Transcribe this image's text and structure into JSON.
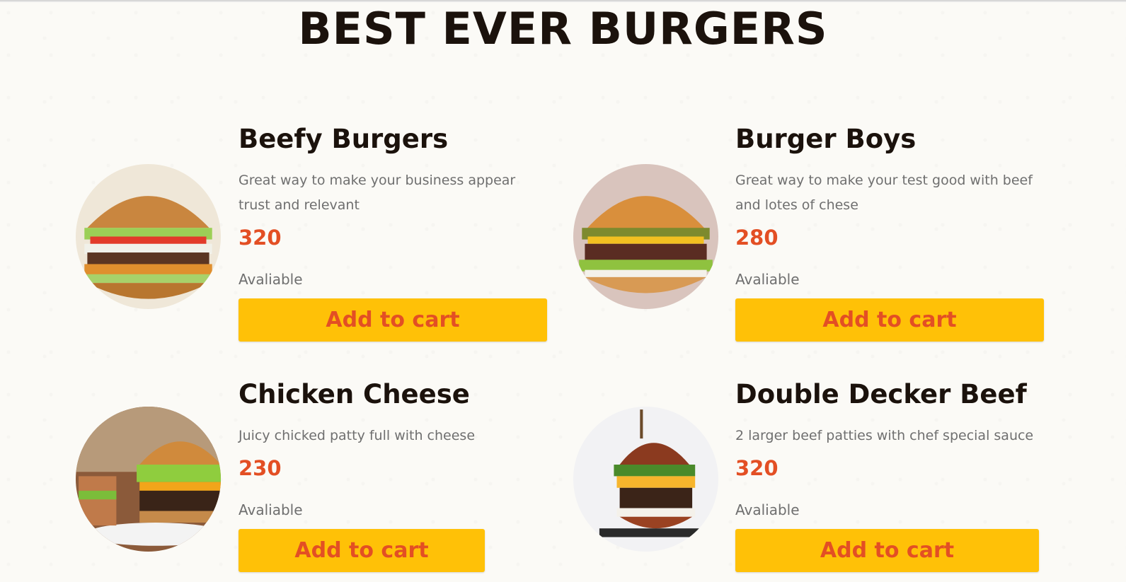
{
  "page": {
    "title": "BEST EVER BURGERS"
  },
  "menu": [
    {
      "name": "Beefy Burgers",
      "description": "Great way to make your business appear trust and relevant",
      "price": "320",
      "status": "Avaliable",
      "button_label": "Add to cart",
      "image": "burger-photo"
    },
    {
      "name": "Burger Boys",
      "description": "Great way to make your test good with beef and lotes of chese",
      "price": "280",
      "status": "Avaliable",
      "button_label": "Add to cart",
      "image": "burger-photo"
    },
    {
      "name": "Chicken Cheese",
      "description": "Juicy chicked patty full with cheese",
      "price": "230",
      "status": "Avaliable",
      "button_label": "Add to cart",
      "image": "burger-photo"
    },
    {
      "name": "Double Decker Beef",
      "description": "2 larger beef patties with chef special sauce",
      "price": "320",
      "status": "Avaliable",
      "button_label": "Add to cart",
      "image": "burger-photo"
    }
  ],
  "colors": {
    "accent": "#e34f24",
    "button": "#ffc107",
    "title": "#1b120c",
    "muted": "#6f6f6f"
  }
}
